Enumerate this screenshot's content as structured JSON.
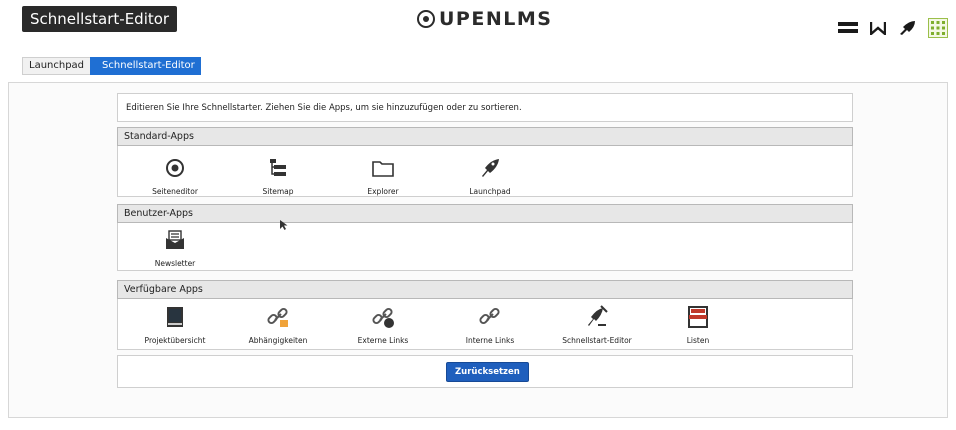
{
  "header": {
    "app_title": "Schnellstart-Editor",
    "logo_text": "UPENLMS",
    "icons": [
      "menu-icon",
      "w-icon",
      "rocket-icon",
      "grid-icon"
    ]
  },
  "breadcrumb": {
    "items": [
      "Launchpad",
      "Schnellstart-Editor"
    ]
  },
  "intro_text": "Editieren Sie Ihre Schnellstarter. Ziehen Sie die Apps, um sie hinzuzufügen oder zu sortieren.",
  "sections": {
    "standard": {
      "title": "Standard-Apps",
      "apps": [
        {
          "label": "Seiteneditor",
          "icon": "target-icon"
        },
        {
          "label": "Sitemap",
          "icon": "sitemap-icon"
        },
        {
          "label": "Explorer",
          "icon": "folder-icon"
        },
        {
          "label": "Launchpad",
          "icon": "rocket-icon"
        }
      ]
    },
    "user": {
      "title": "Benutzer-Apps",
      "apps": [
        {
          "label": "Newsletter",
          "icon": "newsletter-icon"
        }
      ]
    },
    "available": {
      "title": "Verfügbare Apps",
      "apps": [
        {
          "label": "Projektübersicht",
          "icon": "book-icon"
        },
        {
          "label": "Abhängigkeiten",
          "icon": "link-dependency-icon"
        },
        {
          "label": "Externe Links",
          "icon": "link-external-icon"
        },
        {
          "label": "Interne Links",
          "icon": "link-icon"
        },
        {
          "label": "Schnellstart-Editor",
          "icon": "rocket-edit-icon"
        },
        {
          "label": "Listen",
          "icon": "list-icon"
        }
      ]
    }
  },
  "reset_button": "Zurücksetzen",
  "colors": {
    "accent": "#1f6fd3",
    "button": "#1f5fbd",
    "section_header": "#e7e7e7",
    "title_bg": "#2a2a2a"
  }
}
